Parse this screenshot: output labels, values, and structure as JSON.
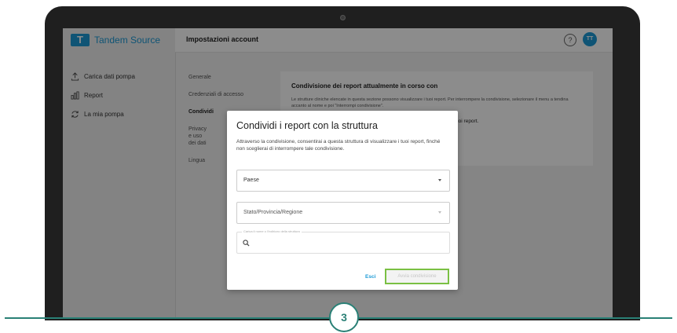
{
  "app": {
    "brand_name": "Tandem Source",
    "brand_mark": "T",
    "brand_color": "#1c9ad6"
  },
  "sidebar": {
    "items": [
      {
        "label": "Carica dati pompa",
        "icon": "upload-icon"
      },
      {
        "label": "Report",
        "icon": "chart-icon"
      },
      {
        "label": "La mia pompa",
        "icon": "sync-icon"
      }
    ]
  },
  "header": {
    "title": "Impostazioni account",
    "help_icon": "?",
    "avatar_initials": "TT"
  },
  "settings_menu": {
    "items": [
      {
        "label": "Generale"
      },
      {
        "label": "Credenziali di accesso"
      },
      {
        "label": "Condividi"
      },
      {
        "label": "Privacy e uso dei dati"
      },
      {
        "label": "Lingua"
      }
    ]
  },
  "panel": {
    "title": "Condivisione dei report attualmente in corso con",
    "text": "Le strutture cliniche elencate in questa sezione possono visualizzare i tuoi report. Per interrompere la condivisione, selezionare il menu a tendina accanto al nome e poi \"Interrompi condivisione\".",
    "text2": "i tuoi report."
  },
  "modal": {
    "title": "Condividi i report con la struttura",
    "description": "Attraverso la condivisione, consentirai a questa struttura di visualizzare i tuoi report, finché non sceglierai di interrompere tale condivisione.",
    "country_label": "Paese",
    "state_label": "Stato/Provincia/Regione",
    "search_label": "Carica il nome o l'indirizzo della struttura",
    "exit_label": "Esci",
    "start_label": "Avvia condivisione"
  },
  "step": {
    "number": "3",
    "color": "#2a8076"
  }
}
